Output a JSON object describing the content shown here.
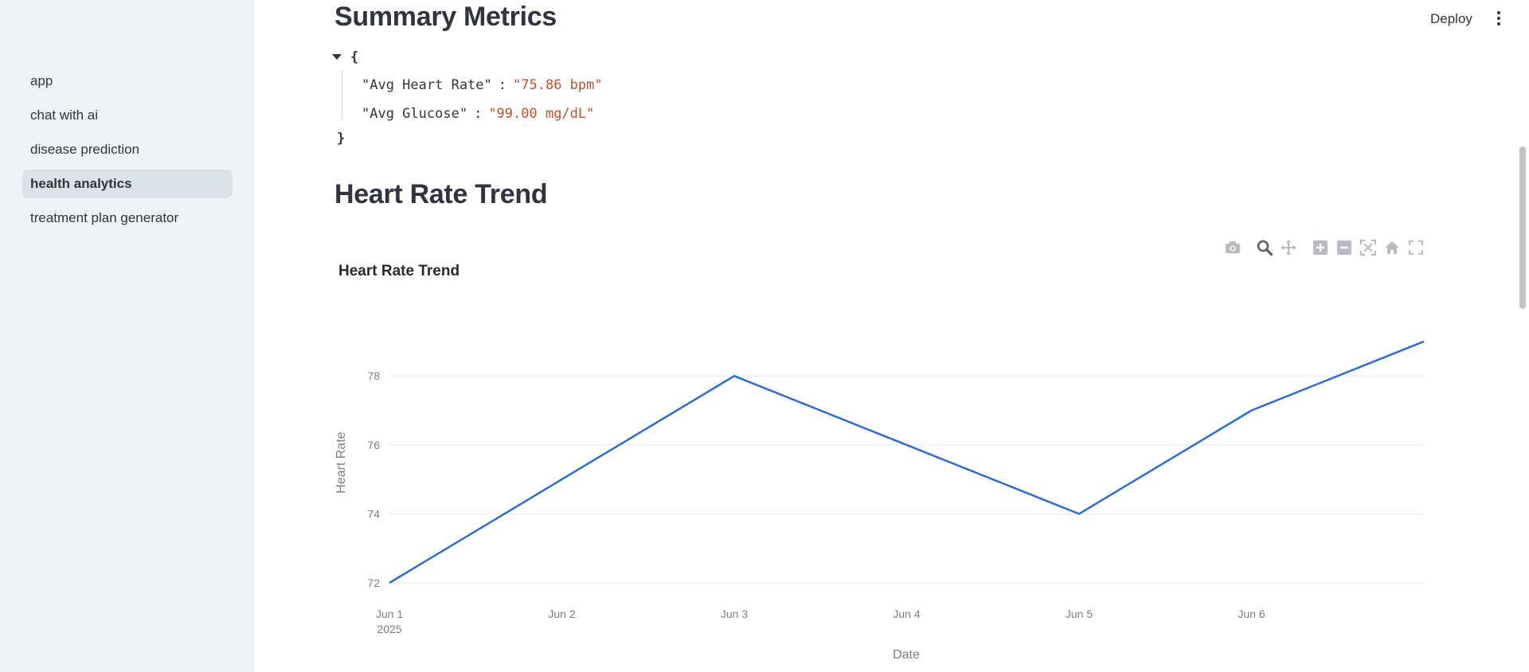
{
  "sidebar": {
    "items": [
      {
        "label": "app",
        "active": false
      },
      {
        "label": "chat with ai",
        "active": false
      },
      {
        "label": "disease prediction",
        "active": false
      },
      {
        "label": "health analytics",
        "active": true
      },
      {
        "label": "treatment plan generator",
        "active": false
      }
    ]
  },
  "header": {
    "deploy_label": "Deploy",
    "menu_icon": "kebab-menu-icon"
  },
  "summary": {
    "title": "Summary Metrics",
    "open_brace": "{",
    "close_brace": "}",
    "entries": [
      {
        "key": "\"Avg Heart Rate\"",
        "value": "\"75.86 bpm\""
      },
      {
        "key": "\"Avg Glucose\"",
        "value": "\"99.00 mg/dL\""
      }
    ]
  },
  "heart_section": {
    "title": "Heart Rate Trend"
  },
  "modebar": {
    "icons": [
      "camera-icon",
      "zoom-icon",
      "pan-icon",
      "zoom-in-icon",
      "zoom-out-icon",
      "autoscale-icon",
      "reset-axes-icon",
      "fullscreen-icon"
    ]
  },
  "colors": {
    "line": "#2f6bc9",
    "grid": "#e6e8ec",
    "sidebar_bg": "#f0f2f6",
    "active_item_bg": "#dde1e8",
    "json_value": "#b5552e"
  },
  "chart_data": {
    "type": "line",
    "title": "Heart Rate Trend",
    "xlabel": "Date",
    "ylabel": "Heart Rate",
    "x": [
      "2025-06-01",
      "2025-06-02",
      "2025-06-03",
      "2025-06-04",
      "2025-06-05",
      "2025-06-06",
      "2025-06-07"
    ],
    "x_tick_labels": [
      {
        "line1": "Jun 1",
        "line2": "2025"
      },
      {
        "line1": "Jun 2",
        "line2": ""
      },
      {
        "line1": "Jun 3",
        "line2": ""
      },
      {
        "line1": "Jun 4",
        "line2": ""
      },
      {
        "line1": "Jun 5",
        "line2": ""
      },
      {
        "line1": "Jun 6",
        "line2": ""
      }
    ],
    "series": [
      {
        "values": [
          72,
          75,
          78,
          76,
          74,
          77,
          79
        ]
      }
    ],
    "y_ticks": [
      72,
      74,
      76,
      78
    ],
    "ylim": [
      72,
      79
    ],
    "grid": true,
    "legend": "none"
  }
}
